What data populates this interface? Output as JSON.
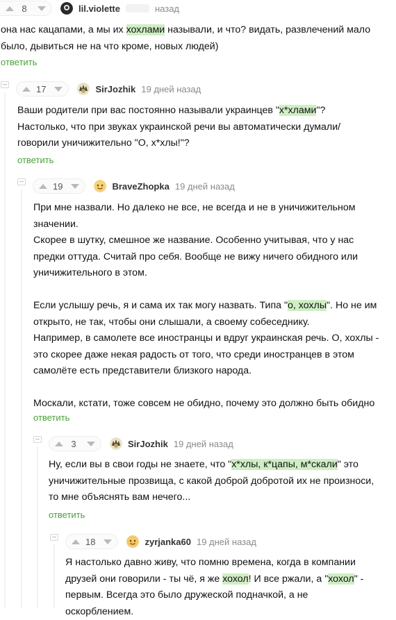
{
  "comments": [
    {
      "score": "8",
      "user": "lil.violette",
      "time": "назад",
      "avatar": "lil-violette-avatar",
      "body": [
        [
          {
            "t": "она нас кацапами, а мы их "
          },
          {
            "t": "хохлами",
            "hl": true
          },
          {
            "t": " называли, и что? видать, развлечений мало было, дывиться не на что кроме, новых людей)"
          }
        ]
      ],
      "reply": "ответить"
    },
    {
      "score": "17",
      "user": "SirJozhik",
      "time": "19 дней назад",
      "avatar": "sirjozhik-avatar",
      "body": [
        [
          {
            "t": "Ваши родители при вас постоянно называли украинцев \""
          },
          {
            "t": "х*хлами",
            "hl": true
          },
          {
            "t": "\"? Настолько, что при звуках украинской речи вы автоматически думали/говорили уничижительно \"О, х*хлы!\"?"
          }
        ]
      ],
      "reply": "ответить"
    },
    {
      "score": "19",
      "user": "BraveZhopka",
      "time": "19 дней назад",
      "avatar": "bravezhopka-avatar",
      "body": [
        [
          {
            "t": "При мне назвали. Но далеко не все, не всегда и не в уничижительном значении."
          }
        ],
        [
          {
            "t": "Скорее в шутку, смешное же название. Особенно учитывая, что у нас предки оттуда. Считай про себя. Вообще не вижу ничего обидного или уничижительного в этом."
          }
        ],
        [],
        [
          {
            "t": "Если услышу речь, я и сама их так могу назвать. Типа \""
          },
          {
            "t": "о, хохлы",
            "hl": true
          },
          {
            "t": "\". Но не им открыто, не так, чтобы они слышали, а своему собеседнику."
          }
        ],
        [
          {
            "t": "Например, в самолете все иностранцы и вдруг украинская речь. О, хохлы - это скорее даже некая радость от того, что среди иностранцев в этом самолёте есть представители близкого народа."
          }
        ],
        [],
        [
          {
            "t": "Москали, кстати, тоже совсем не обидно, почему это должно быть обидно"
          }
        ]
      ],
      "reply": "ответить"
    },
    {
      "score": "3",
      "user": "SirJozhik",
      "time": "19 дней назад",
      "avatar": "sirjozhik-avatar",
      "body": [
        [
          {
            "t": "Ну, если вы в свои годы не знаете, что \""
          },
          {
            "t": "х*хлы, к*цапы, м*скали",
            "hl": true
          },
          {
            "t": "\" это уничижительные прозвища, с какой доброй добротой их не произноси, то мне объяснять вам нечего..."
          }
        ]
      ],
      "reply": "ответить"
    },
    {
      "score": "18",
      "user": "zyrjanka60",
      "time": "19 дней назад",
      "avatar": "zyrjanka60-avatar",
      "body": [
        [
          {
            "t": "Я настолько давно живу, что помню времена, когда в компании друзей они говорили - ты чё, я же "
          },
          {
            "t": "хохол",
            "hl": true
          },
          {
            "t": "! И все ржали, а \""
          },
          {
            "t": "хохол",
            "hl": true
          },
          {
            "t": "\" - первым. Всегда это было дружеской подначкой, а не оскорблением."
          }
        ]
      ],
      "reply": ""
    }
  ]
}
